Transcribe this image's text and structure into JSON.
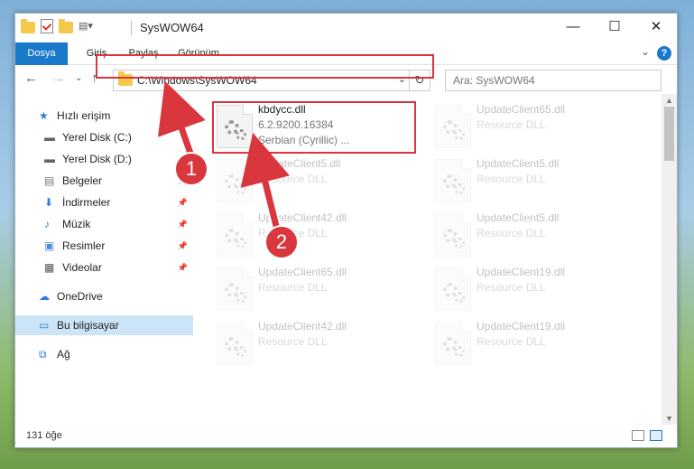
{
  "window": {
    "title": "SysWOW64",
    "controls": {
      "minimize": "—",
      "maximize": "☐",
      "close": "✕"
    }
  },
  "ribbon": {
    "tabs": [
      "Dosya",
      "Giriş",
      "Paylaş",
      "Görünüm"
    ],
    "help": "?"
  },
  "address_bar": {
    "path": "C:\\Windows\\SysWOW64",
    "search_placeholder": "Ara: SysWOW64"
  },
  "sidebar": {
    "items": [
      {
        "label": "Hızlı erişim",
        "icon": "star-icon",
        "pinned": false,
        "selected": false
      },
      {
        "label": "Yerel Disk (C:)",
        "icon": "drive-icon",
        "pinned": false,
        "selected": false
      },
      {
        "label": "Yerel Disk (D:)",
        "icon": "drive-icon",
        "pinned": false,
        "selected": false
      },
      {
        "label": "Belgeler",
        "icon": "documents-icon",
        "pinned": true,
        "selected": false
      },
      {
        "label": "İndirmeler",
        "icon": "download-icon",
        "pinned": true,
        "selected": false
      },
      {
        "label": "Müzik",
        "icon": "music-icon",
        "pinned": true,
        "selected": false
      },
      {
        "label": "Resimler",
        "icon": "pictures-icon",
        "pinned": true,
        "selected": false
      },
      {
        "label": "Videolar",
        "icon": "videos-icon",
        "pinned": true,
        "selected": false
      },
      {
        "label": "OneDrive",
        "icon": "cloud-icon",
        "pinned": false,
        "selected": false
      },
      {
        "label": "Bu bilgisayar",
        "icon": "computer-icon",
        "pinned": false,
        "selected": true
      },
      {
        "label": "Ağ",
        "icon": "network-icon",
        "pinned": false,
        "selected": false
      }
    ]
  },
  "files": [
    {
      "name": "kbdycc.dll",
      "line2": "6.2.9200.16384",
      "line3": "Serbian (Cyrillic) ...",
      "highlighted": true
    },
    {
      "name": "UpdateClient65.dll",
      "line2": "Resource DLL",
      "faded": true
    },
    {
      "name": "UpdateClient5.dll",
      "line2": "Resource DLL",
      "faded": true
    },
    {
      "name": "UpdateClient5.dll",
      "line2": "Resource DLL",
      "faded": true
    },
    {
      "name": "UpdateClient42.dll",
      "line2": "Resource DLL",
      "faded": true
    },
    {
      "name": "UpdateClient5.dll",
      "line2": "Resource DLL",
      "faded": true
    },
    {
      "name": "UpdateClient65.dll",
      "line2": "Resource DLL",
      "faded": true
    },
    {
      "name": "UpdateClient19.dll",
      "line2": "Resource DLL",
      "faded": true
    },
    {
      "name": "UpdateClient42.dll",
      "line2": "Resource DLL",
      "faded": true
    },
    {
      "name": "UpdateClient19.dll",
      "line2": "Resource DLL",
      "faded": true
    }
  ],
  "status": {
    "count": "131 öğe"
  },
  "annotations": {
    "step1": "1",
    "step2": "2",
    "color": "#d9363e"
  }
}
